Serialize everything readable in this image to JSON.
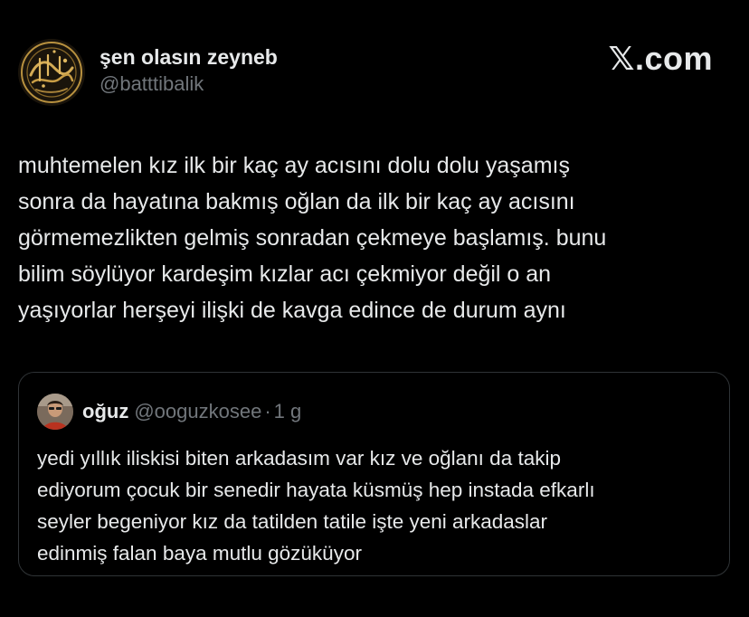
{
  "author": {
    "display_name": "şen olasın zeyneb",
    "handle": "@batttibalik",
    "avatar": "calligraphy-avatar"
  },
  "brand": {
    "label": "𝕏.com"
  },
  "tweet": {
    "lines": [
      "muhtemelen kız ilk bir kaç ay acısını dolu dolu yaşamış",
      "sonra da hayatına bakmış oğlan da ilk bir kaç ay acısını",
      "görmemezlikten gelmiş sonradan çekmeye başlamış. bunu",
      "bilim söylüyor kardeşim kızlar acı çekmiyor değil o an",
      "yaşıyorlar herşeyi ilişki de kavga edince de durum aynı"
    ]
  },
  "quoted_tweet": {
    "display_name": "oğuz",
    "handle": "@ooguzkosee",
    "separator": "·",
    "time": "1 g",
    "avatar": "profile-photo-avatar",
    "lines": [
      "yedi yıllık iliskisi biten arkadasım var kız ve oğlanı da takip",
      "ediyorum çocuk bir senedir hayata küsmüş hep instada efkarlı",
      "seyler begeniyor kız da tatilden tatile işte yeni arkadaslar",
      "edinmiş falan baya mutlu gözüküyor"
    ]
  },
  "colors": {
    "background": "#000000",
    "primary_text": "#e7e9ea",
    "secondary_text": "#71767b",
    "card_border": "#2f3336"
  }
}
